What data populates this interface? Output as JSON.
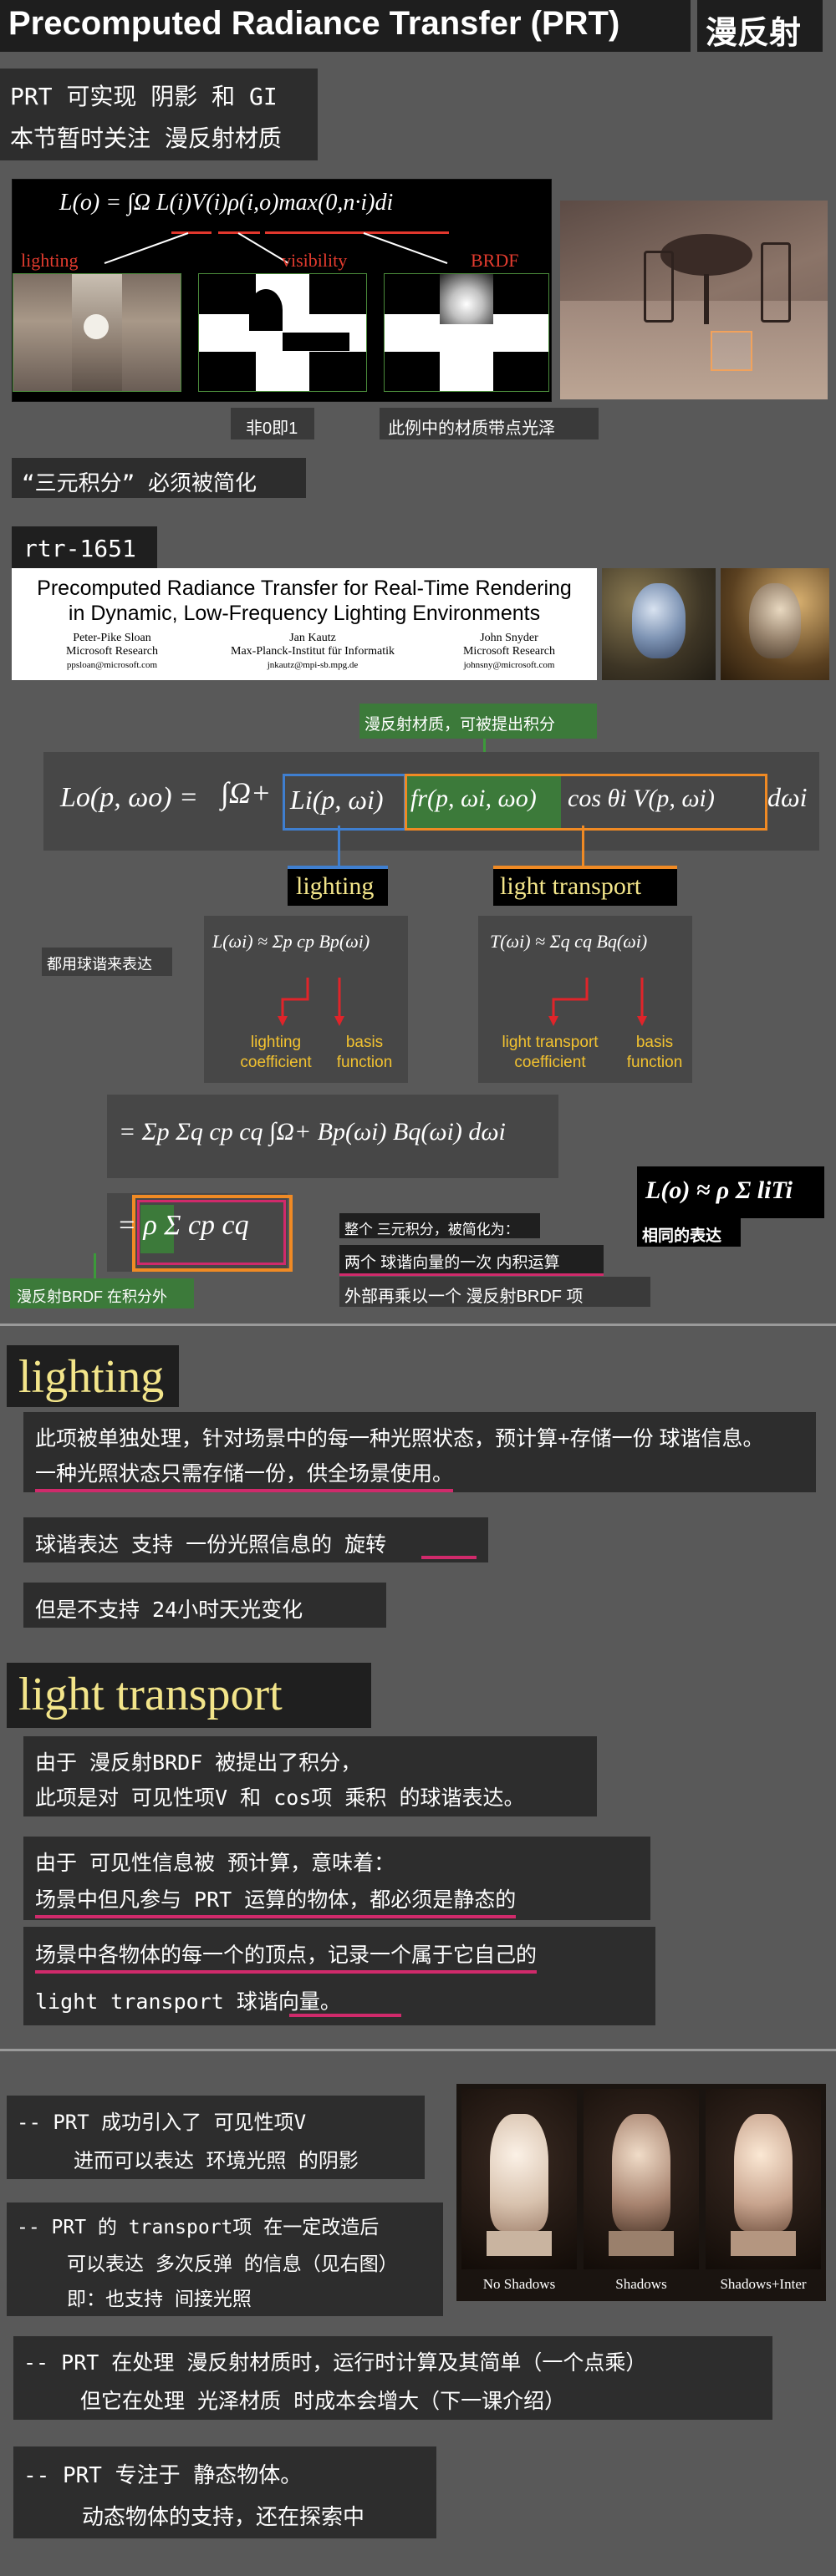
{
  "header": {
    "title": "Precomputed Radiance Transfer (PRT)",
    "badge": "漫反射"
  },
  "intro": {
    "line1": "PRT 可实现 阴影 和 GI",
    "line2": "本节暂时关注 漫反射材质"
  },
  "figure1": {
    "formula": "L(o) = ∫Ω L(i)V(i)ρ(i,o)max(0,n·i)di",
    "label_lighting": "lighting",
    "label_visibility": "visibility",
    "label_brdf": "BRDF",
    "caption_left": "非0即1",
    "caption_right": "此例中的材质带点光泽"
  },
  "triple_integral_note": "“三元积分” 必须被简化",
  "paper": {
    "tag": "rtr-1651",
    "title_line1": "Precomputed Radiance Transfer for Real-Time Rendering",
    "title_line2": "in Dynamic, Low-Frequency Lighting Environments",
    "authors": [
      {
        "name": "Peter-Pike Sloan",
        "org": "Microsoft Research",
        "email": "ppsloan@microsoft.com"
      },
      {
        "name": "Jan Kautz",
        "org": "Max-Planck-Institut für Informatik",
        "email": "jnkautz@mpi-sb.mpg.de"
      },
      {
        "name": "John Snyder",
        "org": "Microsoft Research",
        "email": "johnsny@microsoft.com"
      }
    ]
  },
  "derivation": {
    "diffuse_note": "漫反射材质，可被提出积分",
    "eq_lhs": "Lo(p, ωo) =",
    "eq_integral": "∫Ω+",
    "eq_li": "Li(p, ωi)",
    "eq_fr": "fr(p, ωi, ωo)",
    "eq_rest": "cos θi V(p, ωi)",
    "eq_d": "dωi",
    "lighting_label": "lighting",
    "transport_label": "light transport",
    "sh_note": "都用球谐来表达",
    "lighting_approx": "L(ωi) ≈ Σp cp Bp(ωi)",
    "lighting_coef": "lighting coefficient",
    "lighting_basis": "basis function",
    "transport_approx": "T(ωi) ≈ Σq cq Bq(ωi)",
    "transport_coef": "light transport coefficient",
    "transport_basis": "basis function",
    "double_sum": "= Σp Σq cp cq ∫Ω+ Bp(ωi) Bq(ωi) dωi",
    "simplified": "= ρ Σ cp cq",
    "simplified_note1": "整个 三元积分，被简化为：",
    "simplified_note2": "两个 球谐向量的一次 内积运算",
    "simplified_note3": "外部再乘以一个 漫反射BRDF 项",
    "brdf_out": "漫反射BRDF 在积分外",
    "same_expr": "L(o) ≈ ρ Σ liTi",
    "same_expr_note": "相同的表达"
  },
  "lighting_section": {
    "title": "lighting",
    "para1_line1": "此项被单独处理，针对场景中的每一种光照状态，预计算+存储一份 球谐信息。",
    "para1_line2": "一种光照状态只需存储一份，供全场景使用。",
    "para2": "球谐表达 支持 一份光照信息的 旋转",
    "para3": "但是不支持 24小时天光变化"
  },
  "transport_section": {
    "title": "light transport",
    "para1_line1": "由于 漫反射BRDF 被提出了积分，",
    "para1_line2": "此项是对 可见性项V 和 cos项 乘积 的球谐表达。",
    "para2_line1": "由于 可见性信息被 预计算，意味着：",
    "para2_line2": "场景中但凡参与 PRT 运算的物体，都必须是静态的",
    "para3_line1": "场景中各物体的每一个的顶点，记录一个属于它自己的",
    "para3_line2": "light transport 球谐向量。"
  },
  "summary": {
    "item1_line1": "-- PRT 成功引入了 可见性项V",
    "item1_line2": "进而可以表达 环境光照 的阴影",
    "item2_line1": "-- PRT 的 transport项 在一定改造后",
    "item2_line2": "可以表达 多次反弹 的信息（见右图）",
    "item2_line3": "即：也支持 间接光照",
    "buddha_labels": [
      "No Shadows",
      "Shadows",
      "Shadows+Inter"
    ],
    "item3_line1": "-- PRT 在处理 漫反射材质时，运行时计算及其简单（一个点乘）",
    "item3_line2": "但它在处理 光泽材质 时成本会增大（下一课介绍）",
    "item4_line1": "-- PRT 专注于 静态物体。",
    "item4_line2": "动态物体的支持，还在探索中"
  }
}
